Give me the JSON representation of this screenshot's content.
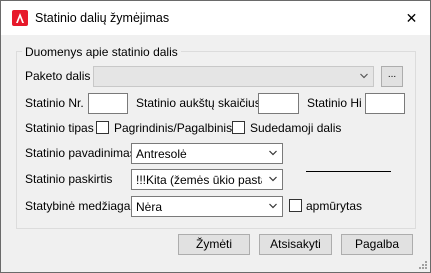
{
  "window": {
    "title": "Statinio dalių žymėjimas",
    "close_glyph": "✕"
  },
  "group": {
    "legend": "Duomenys apie statinio dalis"
  },
  "paketo": {
    "label": "Paketo dalis",
    "value": "",
    "browse_label": "..."
  },
  "row_numbers": {
    "nr_label": "Statinio Nr.",
    "nr_value": "",
    "floors_label": "Statinio aukštų skaičius",
    "floors_value": "",
    "hi_label": "Statinio Hi",
    "hi_value": ""
  },
  "tipas": {
    "label": "Statinio tipas",
    "option1": "Pagrindinis/Pagalbinis",
    "option1_checked": false,
    "option2": "Sudedamoji dalis",
    "option2_checked": false
  },
  "pavadinimas": {
    "label": "Statinio pavadinimas",
    "value": "Antresolė"
  },
  "paskirtis": {
    "label": "Statinio paskirtis",
    "value": "!!!Kita (žemės ūkio pastatui"
  },
  "medziaga": {
    "label": "Statybinė medžiaga",
    "value": "Nėra",
    "apmurytas_label": "apmūrytas",
    "apmurytas_checked": false
  },
  "buttons": {
    "zymeti": "Žymėti",
    "atsisakyti": "Atsisakyti",
    "pagalba": "Pagalba"
  },
  "colors": {
    "app_icon": "#e7192b",
    "window_bg": "#f0f0f0",
    "titlebar_bg": "#ffffff"
  },
  "icons": {
    "app": "autocad-a-icon",
    "close": "close-icon",
    "dropdown": "chevron-down-icon",
    "grip": "resize-grip-icon"
  }
}
